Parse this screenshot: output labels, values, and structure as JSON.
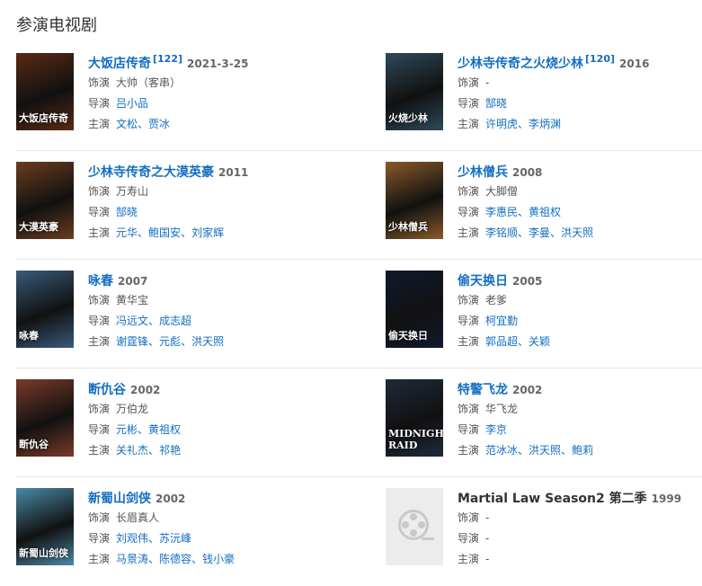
{
  "section_title": "参演电视剧",
  "labels": {
    "role": "饰演",
    "director": "导演",
    "starring": "主演"
  },
  "placeholder_icon": "film-reel-icon",
  "dramas": [
    {
      "title": "大饭店传奇",
      "cite": "[122]",
      "year": "2021-3-25",
      "role": "大帅（客串）",
      "directors": [
        "吕小品"
      ],
      "cast": [
        "文松",
        "贾冰"
      ],
      "poster_text": "大饭店传奇"
    },
    {
      "title": "少林寺传奇之火烧少林",
      "cite": "[120]",
      "year": "2016",
      "role": "-",
      "directors": [
        "郜晓"
      ],
      "cast": [
        "许明虎",
        "李炳渊"
      ],
      "poster_text": "火烧少林"
    },
    {
      "title": "少林寺传奇之大漠英豪",
      "cite": "",
      "year": "2011",
      "role": "万寿山",
      "directors": [
        "郜晓"
      ],
      "cast": [
        "元华",
        "鲍国安",
        "刘家辉"
      ],
      "poster_text": "大漠英豪"
    },
    {
      "title": "少林僧兵",
      "cite": "",
      "year": "2008",
      "role": "大脚僧",
      "directors": [
        "李惠民",
        "黄祖权"
      ],
      "cast": [
        "李铭顺",
        "李曼",
        "洪天照"
      ],
      "poster_text": "少林僧兵"
    },
    {
      "title": "咏春",
      "cite": "",
      "year": "2007",
      "role": "黄华宝",
      "directors": [
        "冯远文",
        "成志超"
      ],
      "cast": [
        "谢霆锋",
        "元彪",
        "洪天照"
      ],
      "poster_text": "咏春"
    },
    {
      "title": "偷天换日",
      "cite": "",
      "year": "2005",
      "role": "老爹",
      "directors": [
        "柯宜勤"
      ],
      "cast": [
        "郭品超",
        "关颖"
      ],
      "poster_text": "偷天换日"
    },
    {
      "title": "断仇谷",
      "cite": "",
      "year": "2002",
      "role": "万伯龙",
      "directors": [
        "元彬",
        "黄祖权"
      ],
      "cast": [
        "关礼杰",
        "祁艳"
      ],
      "poster_text": "断仇谷"
    },
    {
      "title": "特警飞龙",
      "cite": "",
      "year": "2002",
      "role": "华飞龙",
      "directors": [
        "李京"
      ],
      "cast": [
        "范冰冰",
        "洪天照",
        "鲍莉"
      ],
      "poster_text": "MIDNIGHT RAID"
    },
    {
      "title": "新蜀山剑侠",
      "cite": "",
      "year": "2002",
      "role": "长眉真人",
      "directors": [
        "刘观伟",
        "苏沅峰"
      ],
      "cast": [
        "马景涛",
        "陈德容",
        "钱小豪"
      ],
      "poster_text": "新蜀山剑侠"
    },
    {
      "title": "Martial Law Season2 第二季",
      "cite": "",
      "year": "1999",
      "role": "-",
      "directors": [
        "-"
      ],
      "cast": [
        "-"
      ],
      "poster_text": "",
      "no_link": true
    }
  ],
  "poster_colors": [
    "#5a2a14",
    "#2e4a5a",
    "#6b3d1e",
    "#8a5a2a",
    "#3a5a7a",
    "#101a2e",
    "#7a3a2a",
    "#1e2a3a",
    "#4a8aa8",
    "#ececec"
  ]
}
